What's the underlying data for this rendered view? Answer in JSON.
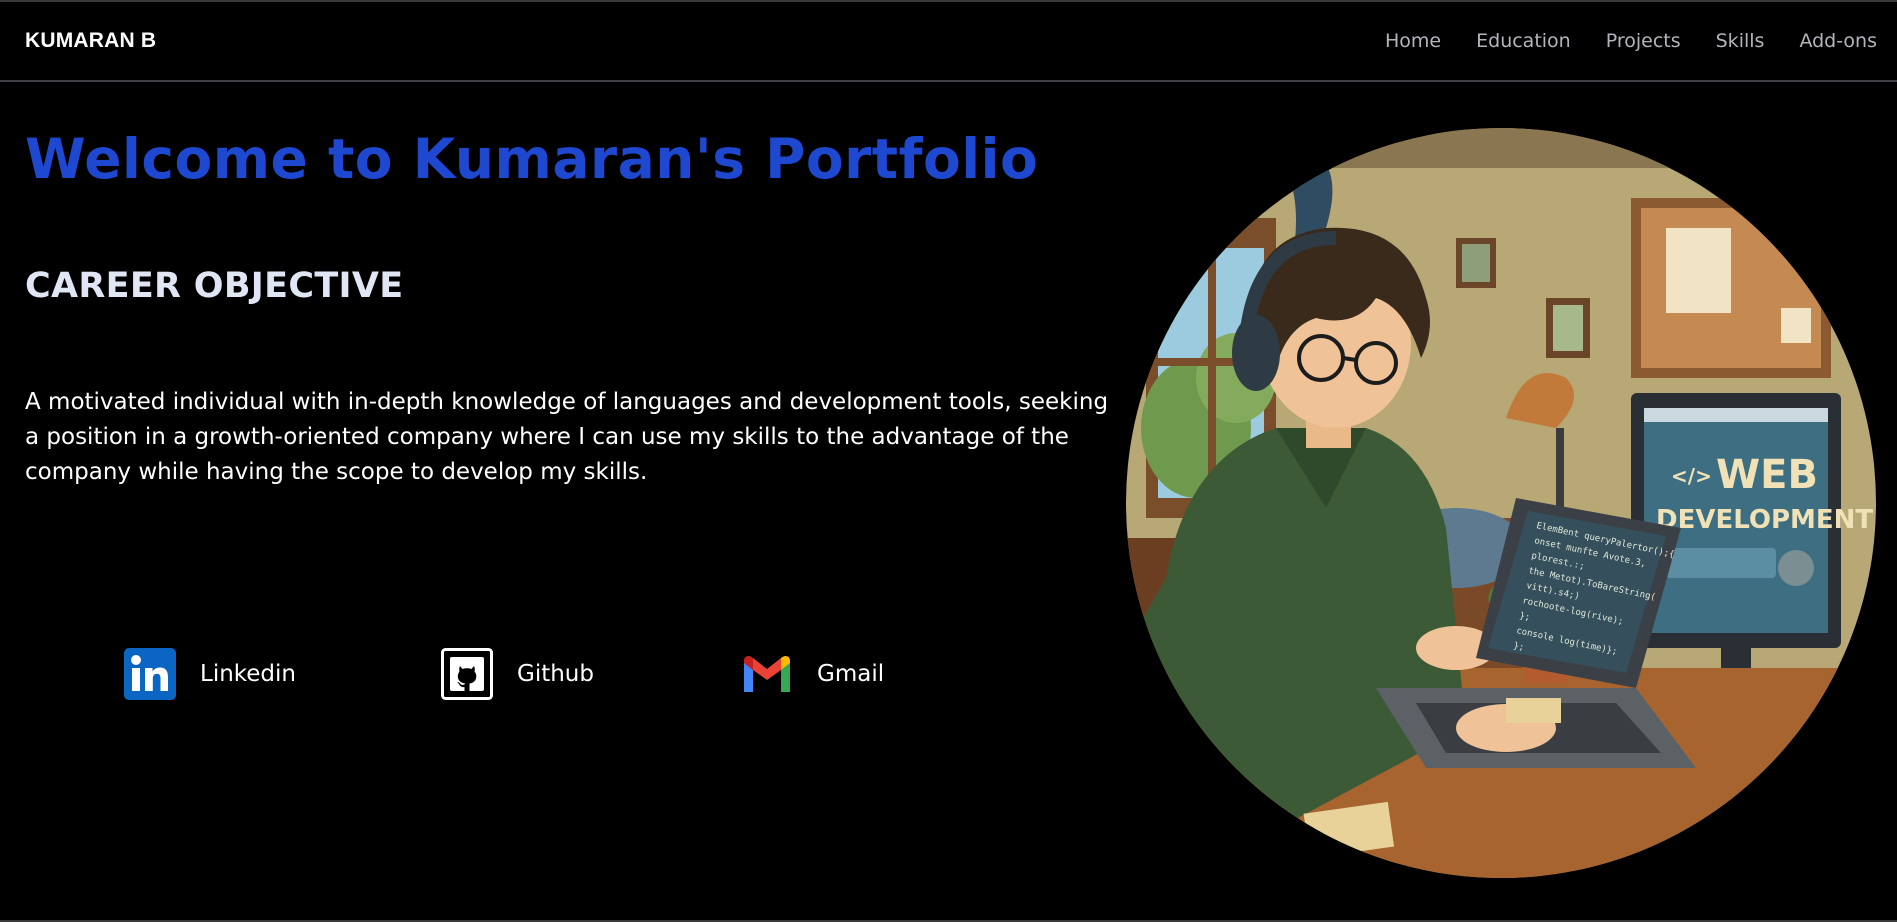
{
  "navbar": {
    "brand": "KUMARAN B",
    "links": [
      "Home",
      "Education",
      "Projects",
      "Skills",
      "Add-ons"
    ]
  },
  "hero": {
    "title": "Welcome to Kumaran's Portfolio",
    "section_heading": "CAREER OBJECTIVE",
    "objective": "A motivated individual with in-depth knowledge of languages and development tools, seeking a position in a growth-oriented company where I can use my skills to the advantage of the company while having the scope to develop my skills."
  },
  "social": [
    {
      "label": "Linkedin",
      "icon": "linkedin-icon"
    },
    {
      "label": "Github",
      "icon": "github-icon"
    },
    {
      "label": "Gmail",
      "icon": "gmail-icon"
    }
  ],
  "illustration": {
    "monitor_line1": "WEB",
    "monitor_line2": "DEVELOPMENT",
    "laptop_code": [
      "ElemBent queryPalertor();{",
      "onset munfte Avote.3,",
      "plorest.:;",
      "the Metot).ToBareString(",
      "vitt).s4;)",
      "rochoote-log(rive);",
      "};",
      "console log(time)};",
      "};"
    ]
  },
  "colors": {
    "background": "#000000",
    "title_blue": "#1f48d1",
    "nav_text": "#b4b4bc",
    "linkedin": "#0a66c2"
  }
}
